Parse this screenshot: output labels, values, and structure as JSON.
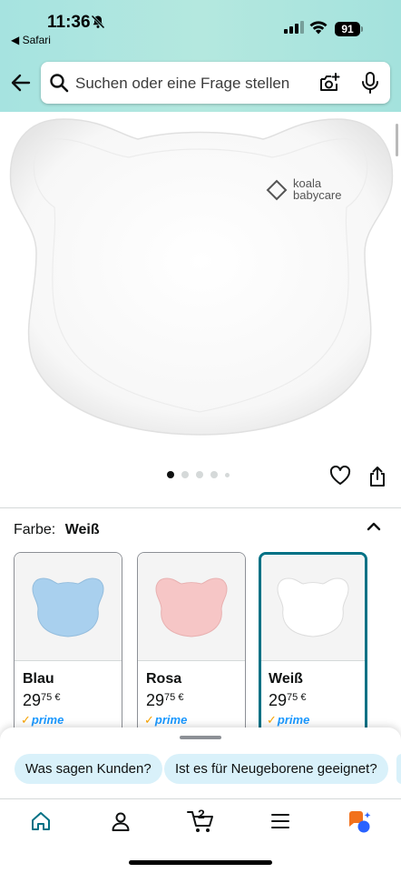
{
  "status_bar": {
    "time": "11:36",
    "back_app": "◀ Safari",
    "battery": "91"
  },
  "search": {
    "placeholder": "Suchen oder eine Frage stellen"
  },
  "product": {
    "brand_logo": "koala babycare",
    "image_count": 5,
    "active_image": 1
  },
  "variant_selector": {
    "label": "Farbe:",
    "selected": "Weiß",
    "options": [
      {
        "name": "Blau",
        "price_whole": "29",
        "price_fraction": "75",
        "currency": "€",
        "prime": "prime",
        "color": "#a9d0ee"
      },
      {
        "name": "Rosa",
        "price_whole": "29",
        "price_fraction": "75",
        "currency": "€",
        "prime": "prime",
        "color": "#f6c6c6"
      },
      {
        "name": "Weiß",
        "price_whole": "29",
        "price_fraction": "75",
        "currency": "€",
        "prime": "prime",
        "color": "#ffffff"
      }
    ]
  },
  "suggestions": {
    "chips": [
      "Was sagen Kunden?",
      "Ist es für Neugeborene geeignet?"
    ]
  },
  "nav": {
    "cart_count": "2",
    "items": [
      "home-icon",
      "account-icon",
      "cart-icon",
      "menu-icon",
      "rufus-ai-icon"
    ]
  },
  "colors": {
    "accent": "#007185",
    "header_gradient": "#a6e3e0",
    "prime_blue": "#1a98ff",
    "nav_active": "#007185"
  }
}
